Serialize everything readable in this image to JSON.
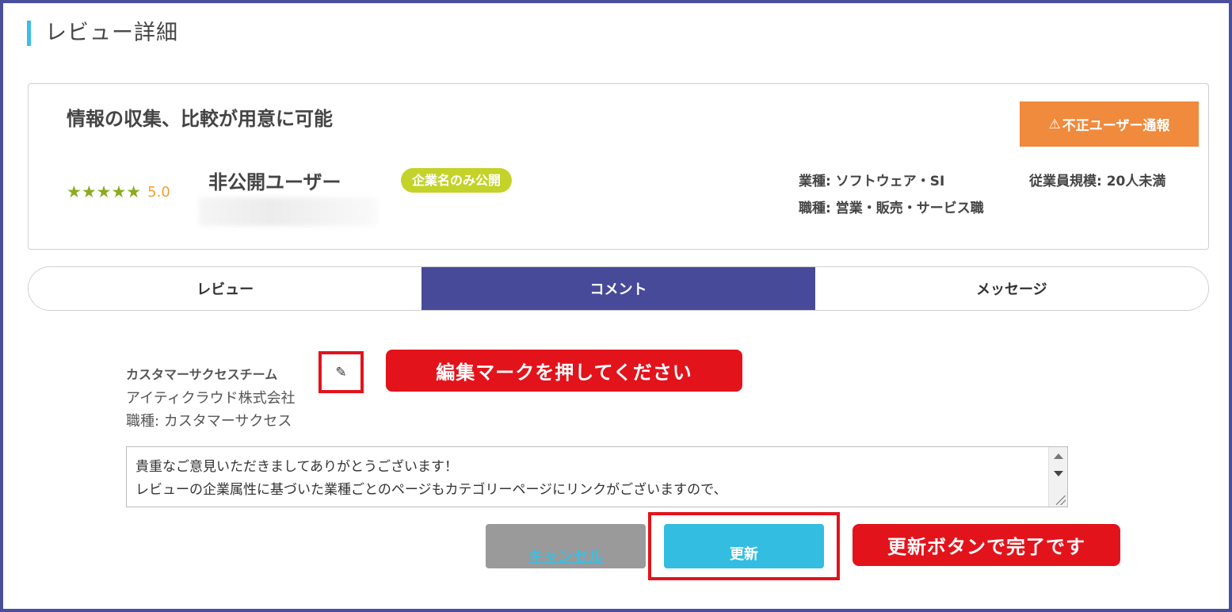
{
  "page": {
    "title": "レビュー詳細"
  },
  "review": {
    "headline": "情報の収集、比較が用意に可能",
    "report_button": "不正ユーザー通報",
    "stars": "★★★★★",
    "rating": "5.0",
    "username": "非公開ユーザー",
    "badge": "企業名のみ公開",
    "industry": "業種: ソフトウェア・SI",
    "employees": "従業員規模: 20人未満",
    "occupation": "職種: 営業・販売・サービス職"
  },
  "tabs": [
    {
      "label": "レビュー",
      "active": false
    },
    {
      "label": "コメント",
      "active": true
    },
    {
      "label": "メッセージ",
      "active": false
    }
  ],
  "comment": {
    "team": "カスタマーサクセスチーム",
    "company": "アイティクラウド株式会社",
    "job": "職種: カスタマーサクセス",
    "text_lines": [
      "貴重なご意見いただきましてありがとうございます！",
      "レビューの企業属性に基づいた業種ごとのページもカテゴリーページにリンクがございますので、"
    ],
    "cancel_label": "キャンセル",
    "update_label": "更新"
  },
  "annotations": {
    "edit_hint": "編集マークを押してください",
    "done_hint": "更新ボタンで完了です"
  },
  "colors": {
    "frame": "#4a4f9c",
    "accent": "#3bbfe3",
    "report": "#f08a3c",
    "active_tab": "#474a98",
    "badge": "#c3d32a",
    "callout": "#e3131b",
    "update": "#33bde0",
    "cancel": "#9a9a9a"
  },
  "icons": {
    "edit": "pencil-icon",
    "warning": "warning-icon",
    "star": "star-icon"
  }
}
